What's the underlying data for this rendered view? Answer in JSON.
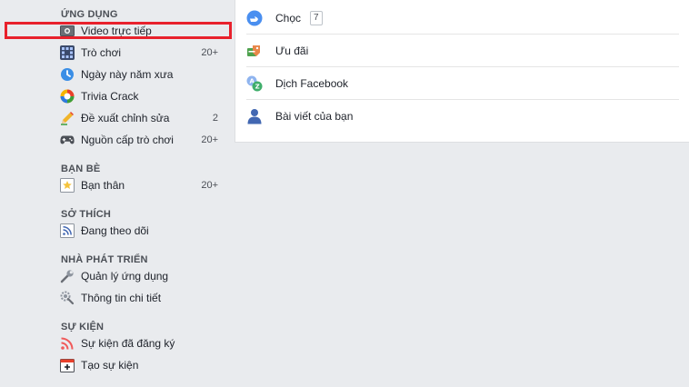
{
  "sidebar": {
    "apps": {
      "title": "ỨNG DỤNG",
      "items": [
        {
          "label": "Video trực tiếp",
          "count": ""
        },
        {
          "label": "Trò chơi",
          "count": "20+"
        },
        {
          "label": "Ngày này năm xưa",
          "count": ""
        },
        {
          "label": "Trivia Crack",
          "count": ""
        },
        {
          "label": "Đề xuất chỉnh sửa",
          "count": "2"
        },
        {
          "label": "Nguồn cấp trò chơi",
          "count": "20+"
        }
      ]
    },
    "friends": {
      "title": "BẠN BÈ",
      "items": [
        {
          "label": "Bạn thân",
          "count": "20+"
        }
      ]
    },
    "interests": {
      "title": "SỞ THÍCH",
      "items": [
        {
          "label": "Đang theo dõi",
          "count": ""
        }
      ]
    },
    "developers": {
      "title": "NHÀ PHÁT TRIỂN",
      "items": [
        {
          "label": "Quản lý ứng dụng",
          "count": ""
        },
        {
          "label": "Thông tin chi tiết",
          "count": ""
        }
      ]
    },
    "events": {
      "title": "SỰ KIỆN",
      "items": [
        {
          "label": "Sự kiện đã đăng ký",
          "count": ""
        },
        {
          "label": "Tạo sự kiện",
          "count": ""
        }
      ]
    }
  },
  "panel": {
    "items": [
      {
        "label": "Chọc",
        "badge": "7"
      },
      {
        "label": "Ưu đãi"
      },
      {
        "label": "Dịch Facebook"
      },
      {
        "label": "Bài viết của bạn"
      }
    ]
  },
  "colors": {
    "highlight": "#e8212c",
    "accent": "#4267b2"
  }
}
